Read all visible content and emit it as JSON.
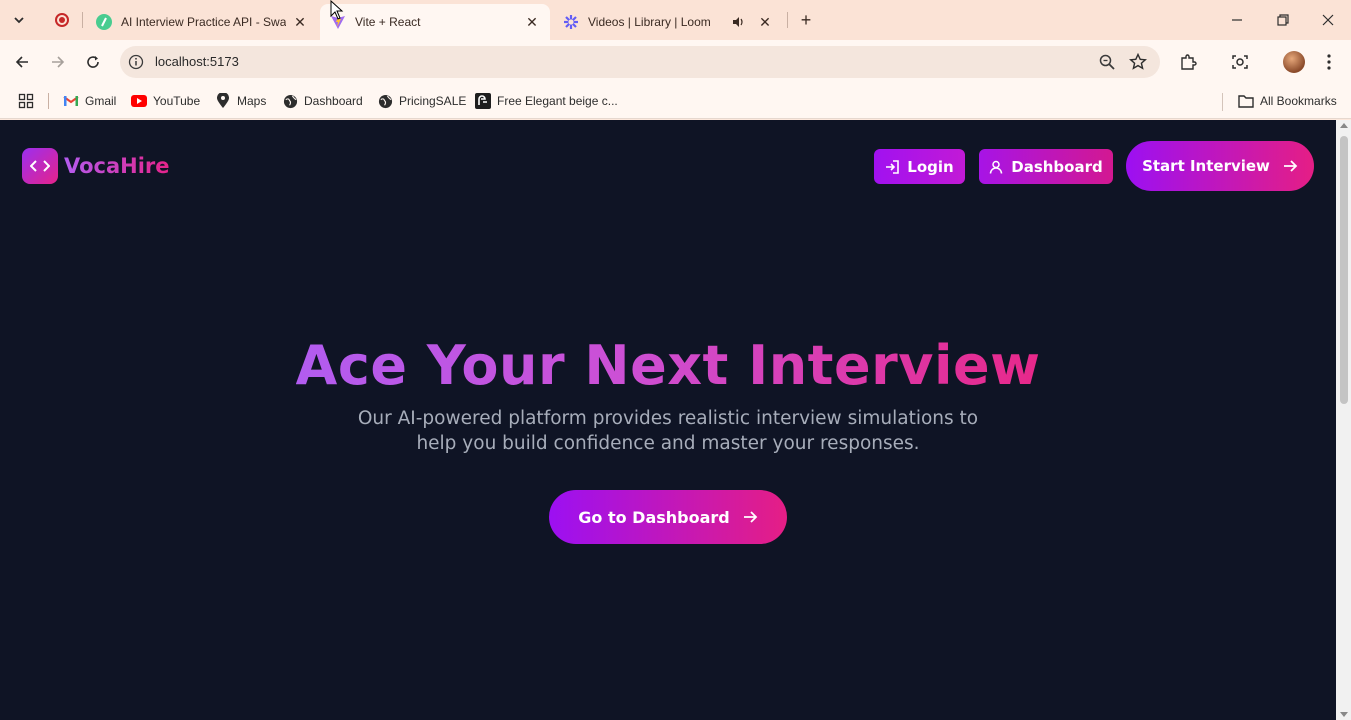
{
  "browser": {
    "tabs": [
      {
        "title": "AI Interview Practice API - Swag",
        "favicon": "swagger-icon",
        "active": false
      },
      {
        "title": "Vite + React",
        "favicon": "vite-icon",
        "active": true
      },
      {
        "title": "Videos | Library | Loom",
        "favicon": "loom-icon",
        "active": false,
        "audio": true
      }
    ],
    "url": "localhost:5173",
    "bookmarks": [
      {
        "label": "Gmail",
        "icon": "gmail-icon"
      },
      {
        "label": "YouTube",
        "icon": "youtube-icon"
      },
      {
        "label": "Maps",
        "icon": "maps-icon"
      },
      {
        "label": "Dashboard",
        "icon": "globe-icon"
      },
      {
        "label": "PricingSALE",
        "icon": "globe-icon"
      },
      {
        "label": "Free Elegant beige c...",
        "icon": "template-icon"
      }
    ],
    "all_bookmarks": "All Bookmarks"
  },
  "app": {
    "brand": "VocaHire",
    "nav": {
      "login": "Login",
      "dashboard": "Dashboard",
      "start_interview": "Start Interview"
    },
    "hero": {
      "title": "Ace Your Next Interview",
      "subtitle_line1": "Our AI-powered platform provides realistic interview simulations to",
      "subtitle_line2": "help you build confidence and master your responses.",
      "cta": "Go to Dashboard"
    },
    "colors": {
      "background": "#0f1425",
      "accent_start": "#9c10f2",
      "accent_end": "#e51e85"
    }
  }
}
